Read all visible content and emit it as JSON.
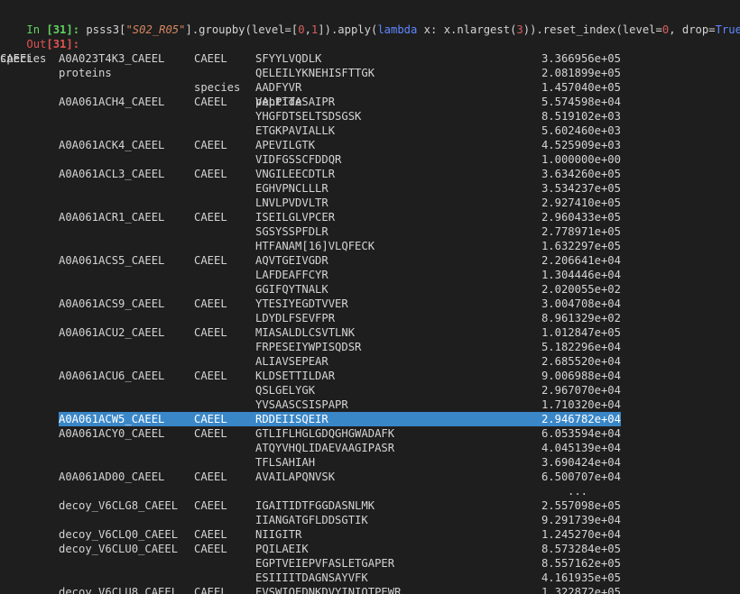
{
  "input": {
    "prompt_label": "In ",
    "prompt_number": "[31]:",
    "code_parts": [
      {
        "text": " psss3[",
        "style": "plain"
      },
      {
        "text": "\"S02_R05\"",
        "style": "str"
      },
      {
        "text": "].groupby(level=[",
        "style": "plain"
      },
      {
        "text": "0",
        "style": "num"
      },
      {
        "text": ",",
        "style": "plain"
      },
      {
        "text": "1",
        "style": "num"
      },
      {
        "text": "]).apply(",
        "style": "plain"
      },
      {
        "text": "lambda",
        "style": "kw"
      },
      {
        "text": " x: x.nlargest(",
        "style": "plain"
      },
      {
        "text": "3",
        "style": "num"
      },
      {
        "text": ")).reset_index(level=",
        "style": "plain"
      },
      {
        "text": "0",
        "style": "num"
      },
      {
        "text": ", drop=",
        "style": "plain"
      },
      {
        "text": "True",
        "style": "kw"
      },
      {
        "text": ")",
        "style": "plain"
      }
    ]
  },
  "output": {
    "prompt_label": "Out",
    "prompt_number": "[31]:"
  },
  "table": {
    "headers": {
      "level0": "species",
      "proteins": "proteins",
      "species": "species",
      "peptide": "peptide"
    },
    "rows": [
      {
        "l0": "CAEEL",
        "protein": "A0A023T4K3_CAEEL",
        "species": "CAEEL",
        "peptide": "SFYYLVQDLK",
        "value": "3.366956e+05"
      },
      {
        "l0": "",
        "protein": "",
        "species": "",
        "peptide": "QELEILYKNEHISFTTGK",
        "value": "2.081899e+05"
      },
      {
        "l0": "",
        "protein": "",
        "species": "",
        "peptide": "AADFYVR",
        "value": "1.457040e+05"
      },
      {
        "l0": "",
        "protein": "A0A061ACH4_CAEEL",
        "species": "CAEEL",
        "peptide": "VALPTTASAIPR",
        "value": "5.574598e+04"
      },
      {
        "l0": "",
        "protein": "",
        "species": "",
        "peptide": "YHGFDTSELTSDSGSK",
        "value": "8.519102e+03"
      },
      {
        "l0": "",
        "protein": "",
        "species": "",
        "peptide": "ETGKPAVIALLK",
        "value": "5.602460e+03"
      },
      {
        "l0": "",
        "protein": "A0A061ACK4_CAEEL",
        "species": "CAEEL",
        "peptide": "APEVILGTK",
        "value": "4.525909e+03"
      },
      {
        "l0": "",
        "protein": "",
        "species": "",
        "peptide": "VIDFGSSCFDDQR",
        "value": "1.000000e+00"
      },
      {
        "l0": "",
        "protein": "A0A061ACL3_CAEEL",
        "species": "CAEEL",
        "peptide": "VNGILEECDTLR",
        "value": "3.634260e+05"
      },
      {
        "l0": "",
        "protein": "",
        "species": "",
        "peptide": "EGHVPNCLLLR",
        "value": "3.534237e+05"
      },
      {
        "l0": "",
        "protein": "",
        "species": "",
        "peptide": "LNVLPVDVLTR",
        "value": "2.927410e+05"
      },
      {
        "l0": "",
        "protein": "A0A061ACR1_CAEEL",
        "species": "CAEEL",
        "peptide": "ISEILGLVPCER",
        "value": "2.960433e+05"
      },
      {
        "l0": "",
        "protein": "",
        "species": "",
        "peptide": "SGSYSSPFDLR",
        "value": "2.778971e+05"
      },
      {
        "l0": "",
        "protein": "",
        "species": "",
        "peptide": "HTFANAM[16]VLQFECK",
        "value": "1.632297e+05"
      },
      {
        "l0": "",
        "protein": "A0A061ACS5_CAEEL",
        "species": "CAEEL",
        "peptide": "AQVTGEIVGDR",
        "value": "2.206641e+04"
      },
      {
        "l0": "",
        "protein": "",
        "species": "",
        "peptide": "LAFDEAFFCYR",
        "value": "1.304446e+04"
      },
      {
        "l0": "",
        "protein": "",
        "species": "",
        "peptide": "GGIFQYTNALK",
        "value": "2.020055e+02"
      },
      {
        "l0": "",
        "protein": "A0A061ACS9_CAEEL",
        "species": "CAEEL",
        "peptide": "YTESIYEGDTVVER",
        "value": "3.004708e+04"
      },
      {
        "l0": "",
        "protein": "",
        "species": "",
        "peptide": "LDYDLFSEVFPR",
        "value": "8.961329e+02"
      },
      {
        "l0": "",
        "protein": "A0A061ACU2_CAEEL",
        "species": "CAEEL",
        "peptide": "MIASALDLCSVTLNK",
        "value": "1.012847e+05"
      },
      {
        "l0": "",
        "protein": "",
        "species": "",
        "peptide": "FRPESEIYWPISQDSR",
        "value": "5.182296e+04"
      },
      {
        "l0": "",
        "protein": "",
        "species": "",
        "peptide": "ALIAVSEPEAR",
        "value": "2.685520e+04"
      },
      {
        "l0": "",
        "protein": "A0A061ACU6_CAEEL",
        "species": "CAEEL",
        "peptide": "KLDSETTILDAR",
        "value": "9.006988e+04"
      },
      {
        "l0": "",
        "protein": "",
        "species": "",
        "peptide": "QSLGELYGK",
        "value": "2.967070e+04"
      },
      {
        "l0": "",
        "protein": "",
        "species": "",
        "peptide": "YVSAASCSISPAPR",
        "value": "1.710320e+04"
      },
      {
        "l0": "",
        "protein": "A0A061ACW5_CAEEL",
        "species": "CAEEL",
        "peptide": "RDDEIISQEIR",
        "value": "2.946782e+04",
        "selected": true
      },
      {
        "l0": "",
        "protein": "A0A061ACY0_CAEEL",
        "species": "CAEEL",
        "peptide": "GTLIFLHGLGDQGHGWADAFK",
        "value": "6.053594e+04"
      },
      {
        "l0": "",
        "protein": "",
        "species": "",
        "peptide": "ATQYVHQLIDAEVAAGIPASR",
        "value": "4.045139e+04"
      },
      {
        "l0": "",
        "protein": "",
        "species": "",
        "peptide": "TFLSAHIAH",
        "value": "3.690424e+04"
      },
      {
        "l0": "",
        "protein": "A0A061AD00_CAEEL",
        "species": "CAEEL",
        "peptide": "AVAILAPQNVSK",
        "value": "6.500707e+04"
      },
      {
        "l0": "",
        "protein": "",
        "species": "",
        "peptide": "",
        "value": "...",
        "ellipsis": true
      },
      {
        "l0": "",
        "protein": "decoy_V6CLG8_CAEEL",
        "species": "CAEEL",
        "peptide": "IGAITIDTFGGDASNLMK",
        "value": "2.557098e+05"
      },
      {
        "l0": "",
        "protein": "",
        "species": "",
        "peptide": "IIANGATGFLDDSGTIK",
        "value": "9.291739e+04"
      },
      {
        "l0": "",
        "protein": "decoy_V6CLQ0_CAEEL",
        "species": "CAEEL",
        "peptide": "NIIGITR",
        "value": "1.245270e+04"
      },
      {
        "l0": "",
        "protein": "decoy_V6CLU0_CAEEL",
        "species": "CAEEL",
        "peptide": "PQILAEIK",
        "value": "8.573284e+05"
      },
      {
        "l0": "",
        "protein": "",
        "species": "",
        "peptide": "EGPTVEIEPVFASLETGAPER",
        "value": "8.557162e+05"
      },
      {
        "l0": "",
        "protein": "",
        "species": "",
        "peptide": "ESIIIITDAGNSAYVFK",
        "value": "4.161935e+05"
      },
      {
        "l0": "",
        "protein": "decoy_V6CLU8_CAEEL",
        "species": "CAEEL",
        "peptide": "EVSWIQEDNKDVYINIQTPEWR",
        "value": "1.322872e+05"
      }
    ]
  },
  "colors": {
    "background": "#1e1e1e",
    "text": "#d4d4d4",
    "prompt_in": "#5fd35f",
    "prompt_out": "#e05252",
    "selection": "#3a87c8"
  }
}
